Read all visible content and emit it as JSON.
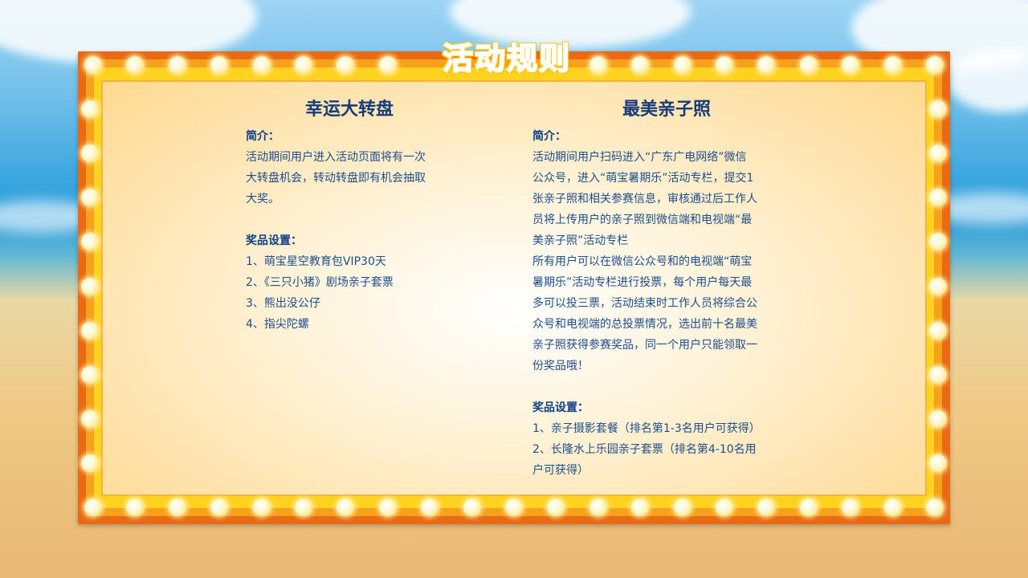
{
  "title": "活动规则",
  "left": {
    "heading": "幸运大转盘",
    "intro_label": "简介：",
    "intro_lines": [
      "活动期间用户进入活动页面将有一次",
      "大转盘机会，转动转盘即有机会抽取",
      "大奖。"
    ],
    "prizes_label": "奖品设置：",
    "prizes": [
      "1、萌宝星空教育包VIP30天",
      "2、《三只小猪》剧场亲子套票",
      "3、熊出没公仔",
      "4、指尖陀螺"
    ]
  },
  "right": {
    "heading": "最美亲子照",
    "intro_label": "简介：",
    "intro_lines": [
      "活动期间用户扫码进入“广东广电网络”微信",
      "公众号，进入“萌宝暑期乐”活动专栏，提交1",
      "张亲子照和相关参赛信息，审核通过后工作人",
      "员将上传用户的亲子照到微信端和电视端“最",
      "美亲子照”活动专栏",
      "所有用户可以在微信公众号和的电视端“萌宝",
      "暑期乐”活动专栏进行投票，每个用户每天最",
      "多可以投三票，活动结束时工作人员将综合公",
      "众号和电视端的总投票情况，选出前十名最美",
      "亲子照获得参赛奖品，同一个用户只能领取一",
      "份奖品哦！"
    ],
    "prizes_label": "奖品设置：",
    "prizes": [
      "1、亲子摄影套餐（排名第1-3名用户可获得）",
      "2、长隆水上乐园亲子套票（排名第4-10名用",
      "户可获得）"
    ]
  }
}
